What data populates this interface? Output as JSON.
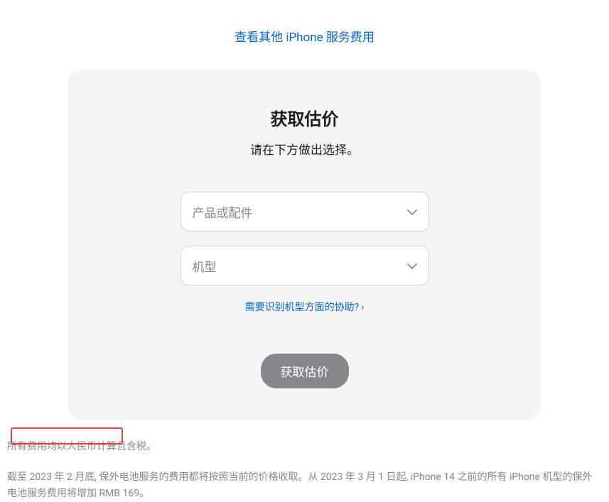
{
  "header": {
    "link_text": "查看其他 iPhone 服务费用"
  },
  "card": {
    "title": "获取估价",
    "subtitle": "请在下方做出选择。",
    "select_product_placeholder": "产品或配件",
    "select_model_placeholder": "机型",
    "help_link": "需要识别机型方面的协助?",
    "submit_label": "获取估价"
  },
  "footer": {
    "line1": "所有费用均以人民币计算且含税。",
    "line2": "截至 2023 年 2 月底, 保外电池服务的费用都将按照当前的价格收取。从 2023 年 3 月 1 日起, iPhone 14 之前的所有 iPhone 机型的保外电池服务费用将增加 RMB 169。"
  }
}
